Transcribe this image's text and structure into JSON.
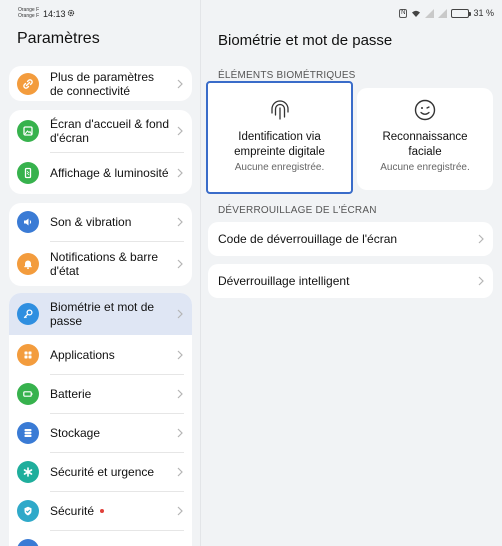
{
  "status_bar": {
    "carrier_1": "Orange F",
    "carrier_2": "Orange F",
    "time": "14:13",
    "nfc": "N",
    "battery_percent": "31 %"
  },
  "left_pane": {
    "title": "Paramètres",
    "items": [
      {
        "label": "Plus de paramètres de connectivité",
        "icon": "link-icon",
        "color": "#f39c3d"
      },
      {
        "label": "Écran d'accueil & fond d'écran",
        "icon": "image-icon",
        "color": "#37b24d"
      },
      {
        "label": "Affichage & luminosité",
        "icon": "phone-display-icon",
        "color": "#37b24d"
      },
      {
        "label": "Son & vibration",
        "icon": "speaker-icon",
        "color": "#3a7bd5"
      },
      {
        "label": "Notifications & barre d'état",
        "icon": "bell-icon",
        "color": "#f39c3d"
      },
      {
        "label": "Biométrie et mot de passe",
        "icon": "key-icon",
        "color": "#2f8fe0"
      },
      {
        "label": "Applications",
        "icon": "apps-grid-icon",
        "color": "#f39c3d"
      },
      {
        "label": "Batterie",
        "icon": "battery-icon",
        "color": "#37b24d"
      },
      {
        "label": "Stockage",
        "icon": "storage-icon",
        "color": "#3a7bd5"
      },
      {
        "label": "Sécurité et urgence",
        "icon": "asterisk-icon",
        "color": "#1fae9c"
      },
      {
        "label": "Sécurité",
        "icon": "shield-check-icon",
        "color": "#2fa9c9"
      }
    ]
  },
  "right_pane": {
    "title": "Biométrie et mot de passe",
    "biometric_section_label": "ÉLÉMENTS BIOMÉTRIQUES",
    "fingerprint": {
      "title_line1": "Identification via",
      "title_line2": "empreinte digitale",
      "status": "Aucune enregistrée."
    },
    "face": {
      "title_line1": "Reconnaissance",
      "title_line2": "faciale",
      "status": "Aucune enregistrée."
    },
    "unlock_section_label": "DÉVERROUILLAGE DE L'ÉCRAN",
    "unlock_code": "Code de déverrouillage de l'écran",
    "smart_unlock": "Déverrouillage intelligent"
  }
}
